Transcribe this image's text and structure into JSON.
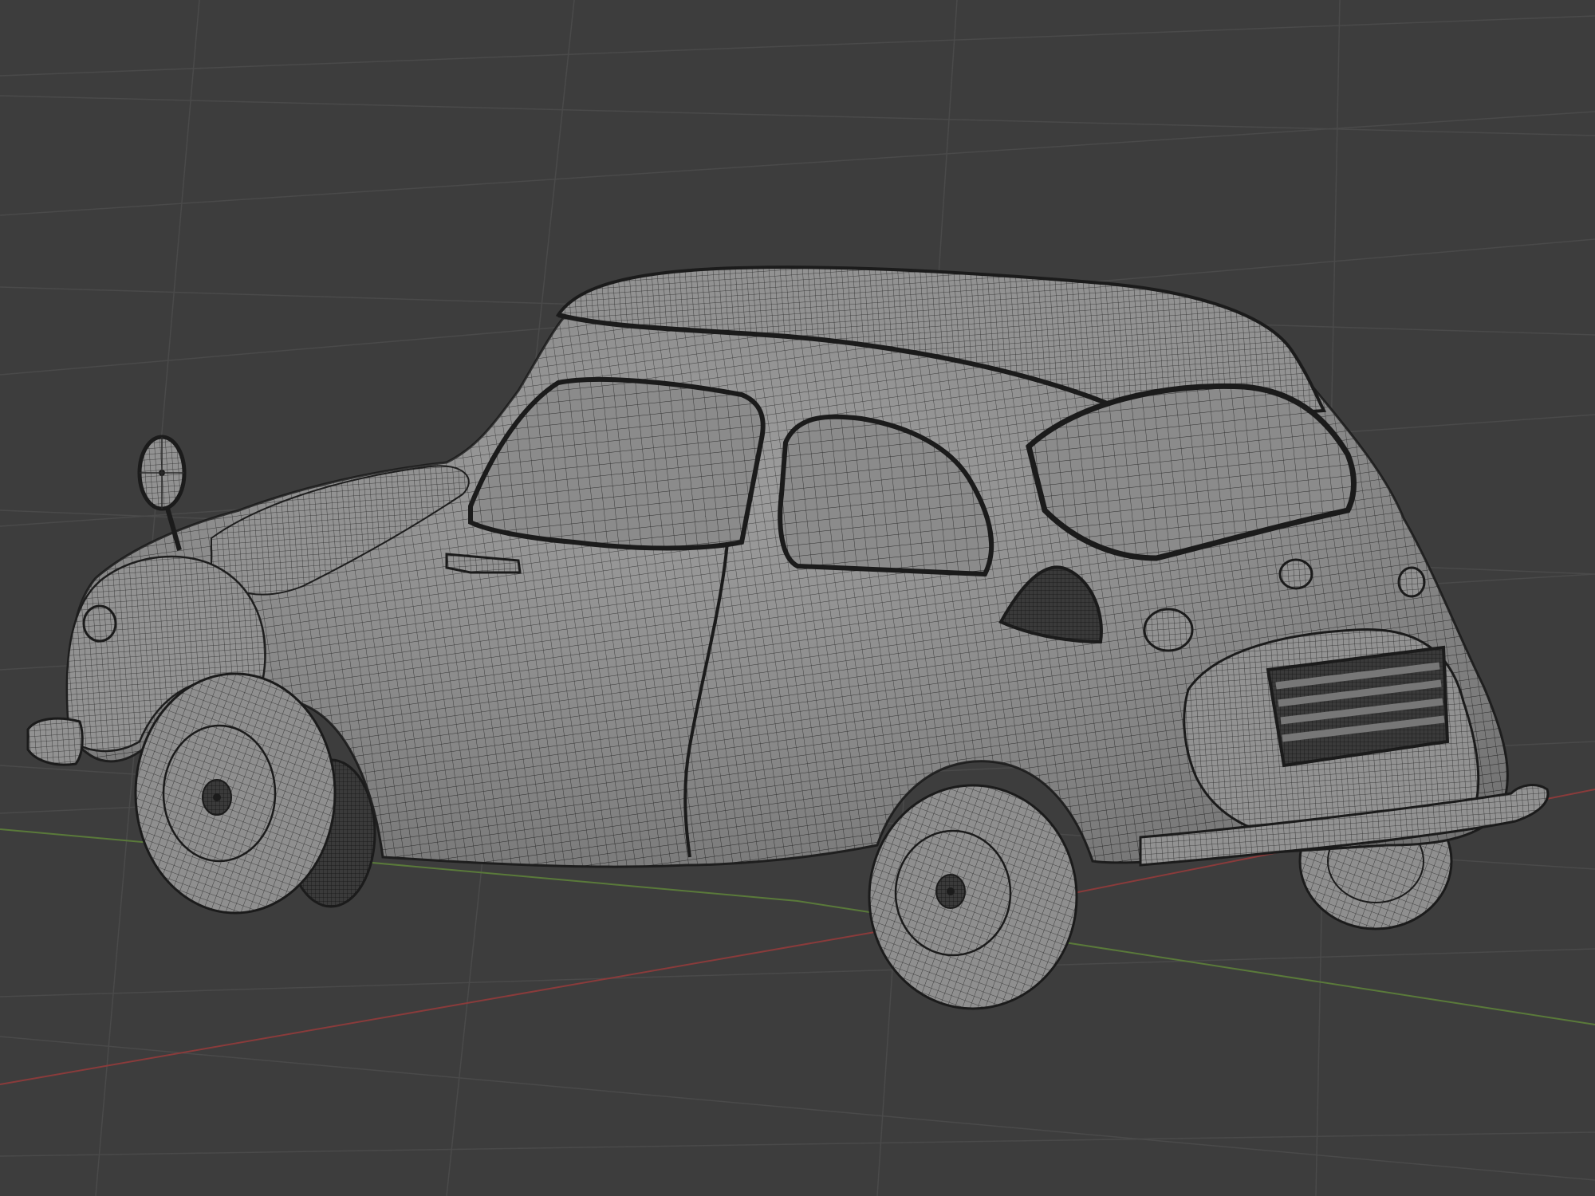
{
  "viewport": {
    "background_color": "#3d3d3d",
    "grid_color": "#4a4a4a",
    "x_axis_color": "#8a3b3b",
    "y_axis_color": "#5a7a3a"
  },
  "model": {
    "display_mode": "wireframe-over-solid",
    "body_color": "#8e8e8e",
    "highlight_color": "#a7a7a7",
    "wire_color": "#2a2a2a",
    "dark_color": "#1b1b1b",
    "glass_color": "#8a8a8a"
  }
}
